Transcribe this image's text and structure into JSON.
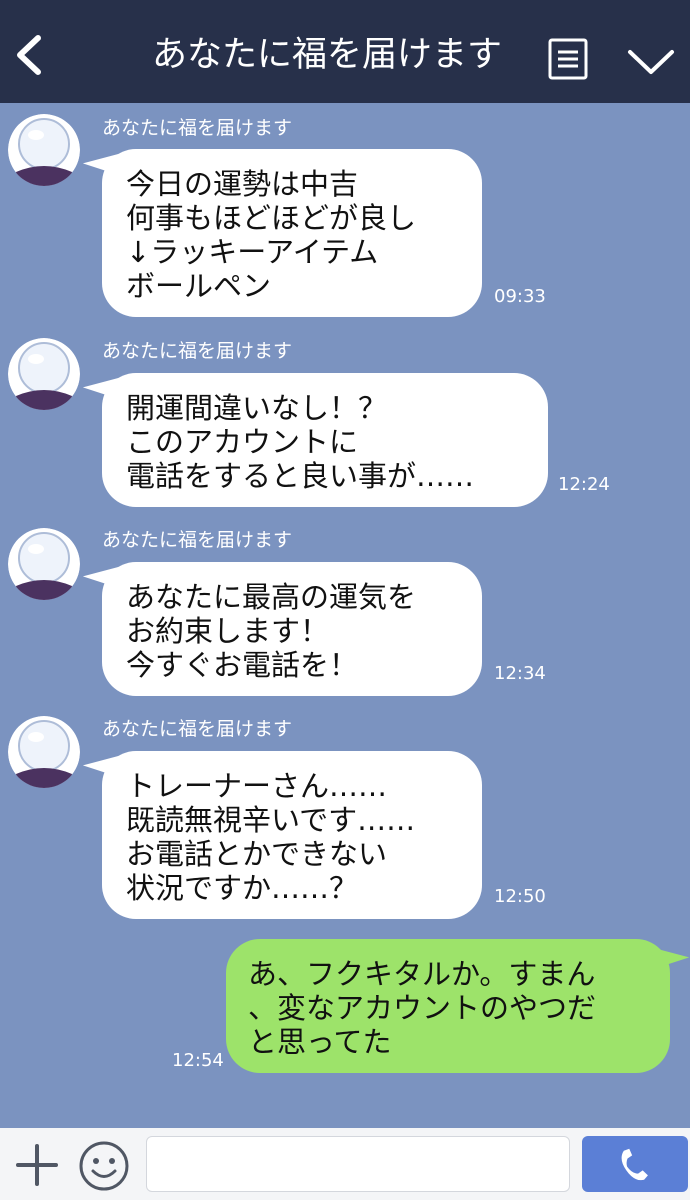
{
  "header": {
    "title": "あなたに福を届けます",
    "back_icon": "back-chevron-icon",
    "menu_icon": "menu-icon",
    "dropdown_icon": "chevron-down-icon",
    "background": "#27304a"
  },
  "chat": {
    "background": "#7b93c0",
    "messages": [
      {
        "sender": "あなたに福を届けます",
        "text": "今日の運勢は中吉\n何事もほどほどが良し\n↓ラッキーアイテム\nボールペン",
        "time": "09:33",
        "direction": "in"
      },
      {
        "sender": "あなたに福を届けます",
        "text": "開運間違いなし！？\nこのアカウントに\n電話をすると良い事が……",
        "time": "12:24",
        "direction": "in"
      },
      {
        "sender": "あなたに福を届けます",
        "text": "あなたに最高の運気を\nお約束します！\n今すぐお電話を！",
        "time": "12:34",
        "direction": "in"
      },
      {
        "sender": "あなたに福を届けます",
        "text": "トレーナーさん……\n既読無視辛いです……\nお電話とかできない\n状況ですか……？",
        "time": "12:50",
        "direction": "in"
      },
      {
        "text": "あ、フクキタルか。すまん\n、変なアカウントのやつだ\nと思ってた",
        "time": "12:54",
        "direction": "out"
      }
    ]
  },
  "footer": {
    "plus_icon": "plus-icon",
    "emoji_icon": "smiley-icon",
    "input_value": "",
    "input_placeholder": "",
    "call_icon": "phone-icon",
    "call_button_color": "#5b7fd6"
  }
}
